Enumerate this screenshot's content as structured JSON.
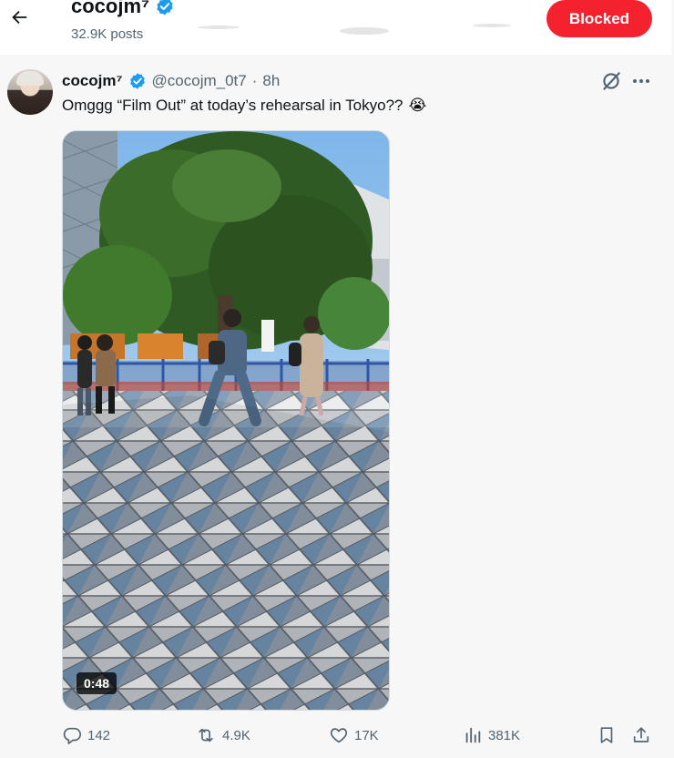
{
  "header": {
    "name": "cocojm⁷",
    "posts": "32.9K posts",
    "blocked_label": "Blocked"
  },
  "tweet": {
    "display_name": "cocojm⁷",
    "handle": "@cocojm_0t7",
    "separator": "·",
    "time": "8h",
    "text": "Omggg “Film Out” at today’s rehearsal in Tokyo??",
    "emoji": "😭",
    "video_duration": "0:48"
  },
  "actions": {
    "replies": "142",
    "reposts": "4.9K",
    "likes": "17K",
    "views": "381K"
  },
  "icons": {
    "back": "back-arrow-icon",
    "verified": "verified-badge-icon",
    "grok": "grok-icon",
    "more": "more-icon",
    "reply": "reply-icon",
    "repost": "repost-icon",
    "like": "heart-icon",
    "views": "views-icon",
    "bookmark": "bookmark-icon",
    "share": "share-icon"
  },
  "colors": {
    "accent": "#1d9bf0",
    "blocked": "#f4212e",
    "muted": "#536471"
  }
}
